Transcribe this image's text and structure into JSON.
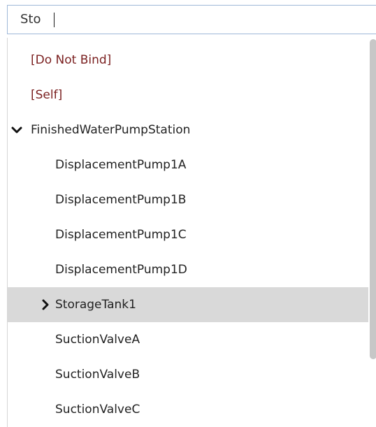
{
  "search": {
    "value": "Sto"
  },
  "items": [
    {
      "label": "[Do Not Bind]"
    },
    {
      "label": "[Self]"
    },
    {
      "label": "FinishedWaterPumpStation",
      "icon": "chevron-down-icon"
    },
    {
      "label": "DisplacementPump1A"
    },
    {
      "label": "DisplacementPump1B"
    },
    {
      "label": "DisplacementPump1C"
    },
    {
      "label": "DisplacementPump1D"
    },
    {
      "label": "StorageTank1",
      "icon": "chevron-right-icon",
      "selected": true
    },
    {
      "label": "SuctionValveA"
    },
    {
      "label": "SuctionValveB"
    },
    {
      "label": "SuctionValveC"
    }
  ],
  "colors": {
    "special_item": "#7a1f1f",
    "selected_row": "#d9d9d9",
    "search_border": "#9fb8d8"
  }
}
